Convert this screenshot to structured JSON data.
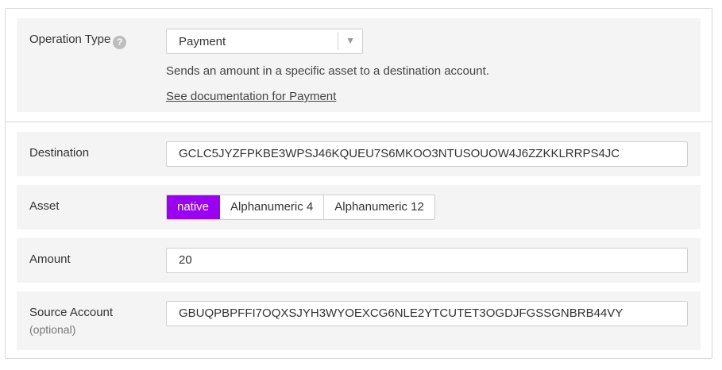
{
  "operation": {
    "label": "Operation Type",
    "help_glyph": "?",
    "selected": "Payment",
    "arrow_glyph": "▼",
    "description": "Sends an amount in a specific asset to a destination account.",
    "doc_link": "See documentation for Payment"
  },
  "destination": {
    "label": "Destination",
    "value": "GCLC5JYZFPKBE3WPSJ46KQUEU7S6MKOO3NTUSOUOW4J6ZZKKLRRPS4JC"
  },
  "asset": {
    "label": "Asset",
    "options": [
      "native",
      "Alphanumeric 4",
      "Alphanumeric 12"
    ],
    "selected": "native"
  },
  "amount": {
    "label": "Amount",
    "value": "20"
  },
  "source_account": {
    "label": "Source Account",
    "sublabel": "(optional)",
    "value": "GBUQPBPFFI7OQXSJYH3WYOEXCG6NLE2YTCUTET3OGDJFGSSGNBRB44VY"
  },
  "colors": {
    "accent": "#9b00f5",
    "section_bg": "#f4f4f4",
    "border": "#d9d9d9"
  }
}
